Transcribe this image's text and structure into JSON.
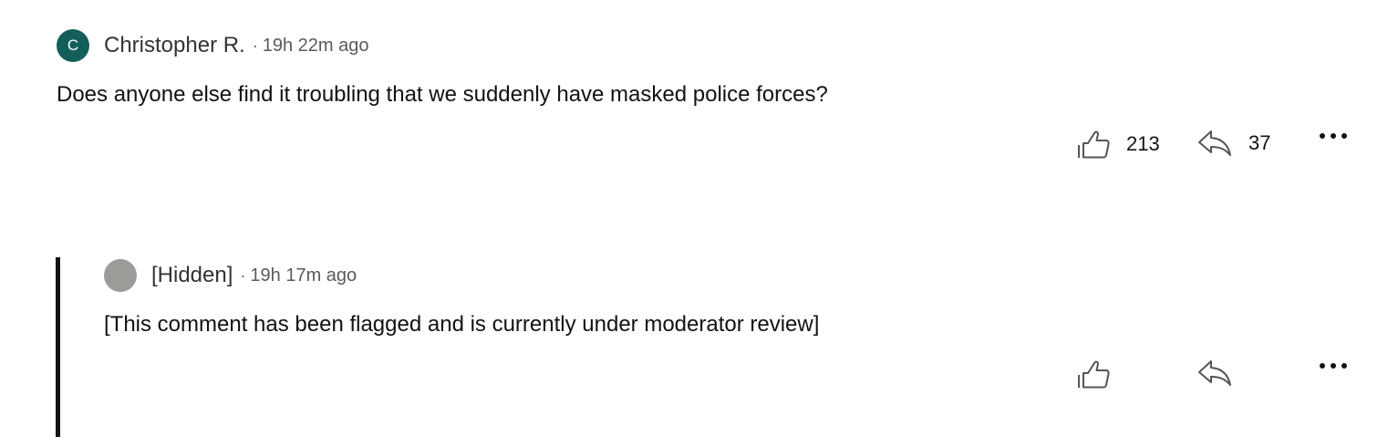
{
  "comments": [
    {
      "avatar_initial": "C",
      "author": "Christopher R.",
      "separator": "·",
      "time": "19h 22m ago",
      "text": "Does anyone else find it troubling that we suddenly have masked police forces?",
      "likes": "213",
      "replies": "37",
      "colors": {
        "avatar": "#135e5a"
      },
      "icons": {
        "like": "thumbs-up-icon",
        "reply": "reply-arrow-icon",
        "more": "more-dots-icon"
      }
    },
    {
      "avatar_initial": "",
      "author": "[Hidden]",
      "separator": "·",
      "time": "19h 17m ago",
      "text": "[This comment has been flagged and is currently under moderator review]",
      "likes": "",
      "replies": "",
      "colors": {
        "avatar": "#9b9b98"
      },
      "icons": {
        "like": "thumbs-up-icon",
        "reply": "reply-arrow-icon",
        "more": "more-dots-icon"
      }
    }
  ]
}
